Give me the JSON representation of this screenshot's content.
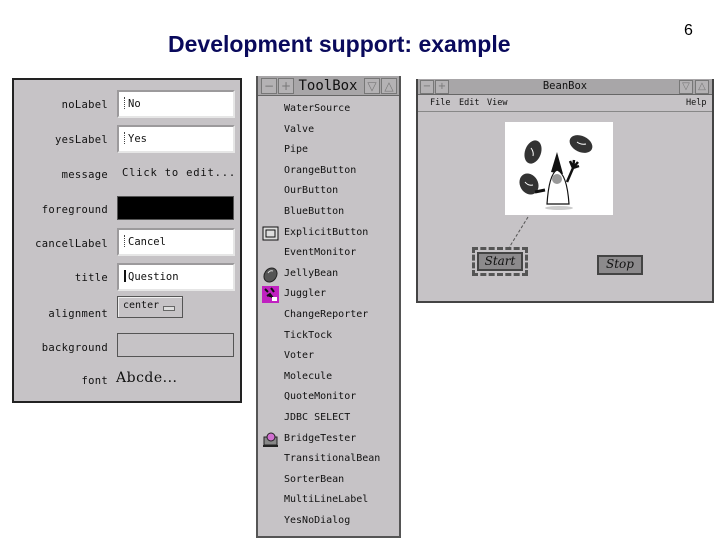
{
  "slide": {
    "title": "Development support: example",
    "page_number": "6"
  },
  "property_sheet": {
    "rows": [
      {
        "label": "noLabel",
        "type": "text",
        "value": "No"
      },
      {
        "label": "yesLabel",
        "type": "text",
        "value": "Yes"
      },
      {
        "label": "message",
        "type": "plain",
        "value": "Click to edit..."
      },
      {
        "label": "foreground",
        "type": "color",
        "value": "#000000"
      },
      {
        "label": "cancelLabel",
        "type": "text",
        "value": "Cancel"
      },
      {
        "label": "title",
        "type": "text",
        "value": "Question"
      },
      {
        "label": "alignment",
        "type": "choice",
        "value": "center"
      },
      {
        "label": "background",
        "type": "color",
        "value": "#c6c3c6"
      },
      {
        "label": "font",
        "type": "font",
        "value": "Abcde..."
      }
    ]
  },
  "toolbox": {
    "title": "ToolBox",
    "window_buttons": {
      "minimize": "−",
      "maximize": "+",
      "lower": "▽",
      "raise": "△"
    },
    "items": [
      {
        "label": "WaterSource",
        "icon": ""
      },
      {
        "label": "Valve",
        "icon": ""
      },
      {
        "label": "Pipe",
        "icon": ""
      },
      {
        "label": "OrangeButton",
        "icon": ""
      },
      {
        "label": "OurButton",
        "icon": ""
      },
      {
        "label": "BlueButton",
        "icon": ""
      },
      {
        "label": "ExplicitButton",
        "icon": "button-icon"
      },
      {
        "label": "EventMonitor",
        "icon": ""
      },
      {
        "label": "JellyBean",
        "icon": "jellybean-icon"
      },
      {
        "label": "Juggler",
        "icon": "juggler-icon"
      },
      {
        "label": "ChangeReporter",
        "icon": ""
      },
      {
        "label": "TickTock",
        "icon": ""
      },
      {
        "label": "Voter",
        "icon": ""
      },
      {
        "label": "Molecule",
        "icon": ""
      },
      {
        "label": "QuoteMonitor",
        "icon": ""
      },
      {
        "label": "JDBC SELECT",
        "icon": ""
      },
      {
        "label": "BridgeTester",
        "icon": "bridge-tester-icon"
      },
      {
        "label": "TransitionalBean",
        "icon": ""
      },
      {
        "label": "SorterBean",
        "icon": ""
      },
      {
        "label": "MultiLineLabel",
        "icon": ""
      },
      {
        "label": "YesNoDialog",
        "icon": ""
      }
    ]
  },
  "beanbox": {
    "title": "BeanBox",
    "menus": {
      "file": "File",
      "edit": "Edit",
      "view": "View",
      "help": "Help"
    },
    "buttons": {
      "start": "Start",
      "stop": "Stop"
    },
    "selected_bean": "Start"
  }
}
